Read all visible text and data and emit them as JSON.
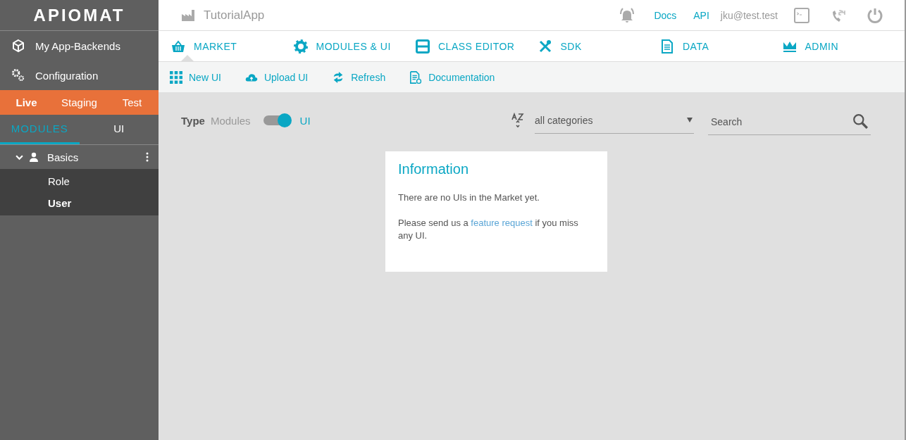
{
  "logo": {
    "text": "APIOMAT"
  },
  "sidebar": {
    "items": [
      {
        "label": "My App-Backends",
        "kind": "cube"
      },
      {
        "label": "Configuration",
        "kind": "gears"
      }
    ],
    "environments": [
      {
        "label": "Live",
        "selected": true
      },
      {
        "label": "Staging",
        "selected": false
      },
      {
        "label": "Test",
        "selected": false
      }
    ],
    "tabs": [
      {
        "label": "MODULES",
        "selected": true
      },
      {
        "label": "UI",
        "selected": false
      }
    ],
    "tree": [
      {
        "label": "Basics",
        "expanded": true,
        "children": [
          {
            "label": "Role",
            "selected": false
          },
          {
            "label": "User",
            "selected": true
          }
        ]
      }
    ]
  },
  "header": {
    "app_name": "TutorialApp",
    "links": [
      "Docs",
      "API"
    ],
    "user": "jku@test.test"
  },
  "nav_tabs": [
    {
      "label": "MARKET",
      "kind": "basket",
      "selected": true
    },
    {
      "label": "MODULES & UI",
      "kind": "gear",
      "selected": false
    },
    {
      "label": "CLASS EDITOR",
      "kind": "editor",
      "selected": false
    },
    {
      "label": "SDK",
      "kind": "tools",
      "selected": false
    },
    {
      "label": "DATA",
      "kind": "document",
      "selected": false
    },
    {
      "label": "ADMIN",
      "kind": "crown",
      "selected": false
    }
  ],
  "toolbar": [
    {
      "label": "New UI",
      "kind": "grid"
    },
    {
      "label": "Upload UI",
      "kind": "cloud"
    },
    {
      "label": "Refresh",
      "kind": "refresh"
    },
    {
      "label": "Documentation",
      "kind": "doc"
    }
  ],
  "filter": {
    "type_label": "Type",
    "off_label": "Modules",
    "on_label": "UI",
    "on": true,
    "category": "all categories",
    "search_placeholder": "Search"
  },
  "info_card": {
    "title": "Information",
    "message": "There are no UIs in the Market yet.",
    "request_before": "Please send us a ",
    "request_link": "feature request",
    "request_after": " if you miss any UI."
  }
}
